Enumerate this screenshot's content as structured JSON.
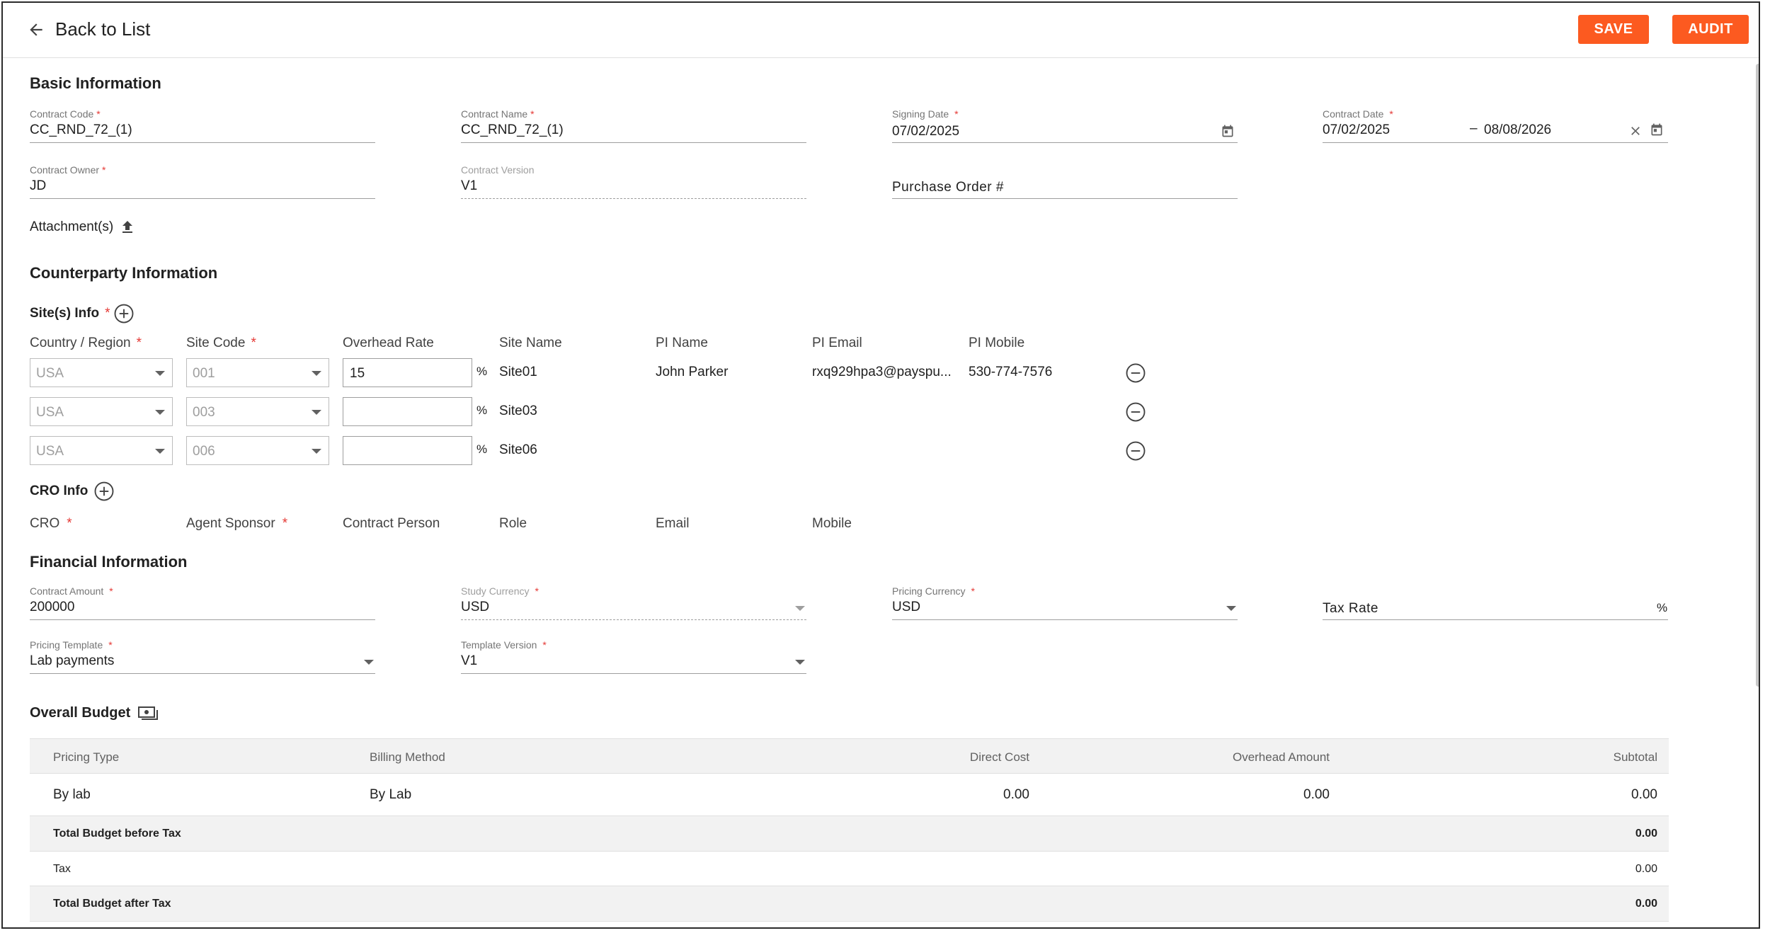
{
  "topbar": {
    "back_label": "Back to List",
    "save_label": "SAVE",
    "audit_label": "AUDIT"
  },
  "basic": {
    "title": "Basic Information",
    "contract_code": {
      "label": "Contract Code",
      "value": "CC_RND_72_(1)"
    },
    "contract_name": {
      "label": "Contract Name",
      "value": "CC_RND_72_(1)"
    },
    "signing_date": {
      "label": "Signing Date",
      "value": "07/02/2025"
    },
    "contract_date": {
      "label": "Contract Date",
      "start": "07/02/2025",
      "dash": "–",
      "end": "08/08/2026"
    },
    "contract_owner": {
      "label": "Contract Owner",
      "value": "JD"
    },
    "contract_version": {
      "label": "Contract Version",
      "value": "V1"
    },
    "purchase_order": {
      "placeholder": "Purchase Order #"
    },
    "attachments_label": "Attachment(s)",
    "required_mark": "*"
  },
  "counterparty": {
    "title": "Counterparty Information",
    "sites_title": "Site(s) Info",
    "columns": [
      "Country / Region",
      "Site Code",
      "Overhead Rate",
      "Site Name",
      "PI Name",
      "PI Email",
      "PI Mobile"
    ],
    "percent": "%",
    "sites": [
      {
        "country": "USA",
        "code": "001",
        "overhead": "15",
        "site_name": "Site01",
        "pi_name": "John Parker",
        "pi_email": "rxq929hpa3@payspu...",
        "pi_mobile": "530-774-7576"
      },
      {
        "country": "USA",
        "code": "003",
        "overhead": "",
        "site_name": "Site03",
        "pi_name": "",
        "pi_email": "",
        "pi_mobile": ""
      },
      {
        "country": "USA",
        "code": "006",
        "overhead": "",
        "site_name": "Site06",
        "pi_name": "",
        "pi_email": "",
        "pi_mobile": ""
      }
    ],
    "cro_title": "CRO Info",
    "cro_columns": [
      "CRO",
      "Agent Sponsor",
      "Contract Person",
      "Role",
      "Email",
      "Mobile"
    ]
  },
  "financial": {
    "title": "Financial Information",
    "contract_amount": {
      "label": "Contract Amount",
      "value": "200000"
    },
    "study_currency": {
      "label": "Study Currency",
      "value": "USD"
    },
    "pricing_currency": {
      "label": "Pricing Currency",
      "value": "USD"
    },
    "tax_rate": {
      "placeholder": "Tax Rate",
      "suffix": "%"
    },
    "pricing_template": {
      "label": "Pricing Template",
      "value": "Lab payments"
    },
    "template_version": {
      "label": "Template Version",
      "value": "V1"
    }
  },
  "budget": {
    "title": "Overall Budget",
    "headers": {
      "pricing_type": "Pricing Type",
      "billing_method": "Billing Method",
      "direct_cost": "Direct Cost",
      "overhead_amount": "Overhead Amount",
      "subtotal": "Subtotal"
    },
    "row": {
      "pricing_type": "By lab",
      "billing_method": "By Lab",
      "direct_cost": "0.00",
      "overhead_amount": "0.00",
      "subtotal": "0.00"
    },
    "total_before_tax": {
      "label": "Total Budget before Tax",
      "value": "0.00"
    },
    "tax": {
      "label": "Tax",
      "value": "0.00"
    },
    "total_after_tax": {
      "label": "Total Budget after Tax",
      "value": "0.00"
    }
  }
}
